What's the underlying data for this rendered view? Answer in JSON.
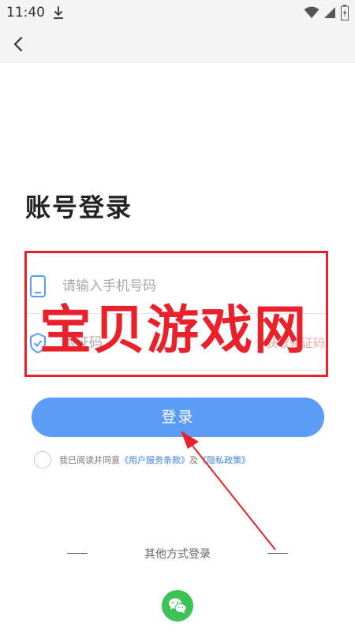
{
  "status_bar": {
    "time": "11:40",
    "icons": [
      "download-icon",
      "wifi-icon",
      "signal-icon",
      "battery-icon"
    ]
  },
  "nav": {
    "back_icon": "chevron-left-icon"
  },
  "page": {
    "title": "账号登录"
  },
  "form": {
    "phone": {
      "icon": "phone-icon",
      "value": "",
      "placeholder": "请输入手机号码"
    },
    "code": {
      "icon": "shield-check-icon",
      "value": "",
      "placeholder": "验证码",
      "get_code_label": "获取验证码"
    }
  },
  "login_button": {
    "label": "登录"
  },
  "agreement": {
    "checked": false,
    "prefix": "我已阅读并同意",
    "terms_link": "《用户服务条款》",
    "conjunction": "及",
    "privacy_link": "《隐私政策》"
  },
  "other_login": {
    "title": "其他方式登录",
    "wechat_icon": "wechat-icon"
  },
  "overlay": {
    "watermark": "宝贝游戏网",
    "accent_color": "#e8212b"
  },
  "colors": {
    "primary": "#5a9cf6",
    "link": "#3a82e8",
    "wechat": "#3dc256"
  }
}
